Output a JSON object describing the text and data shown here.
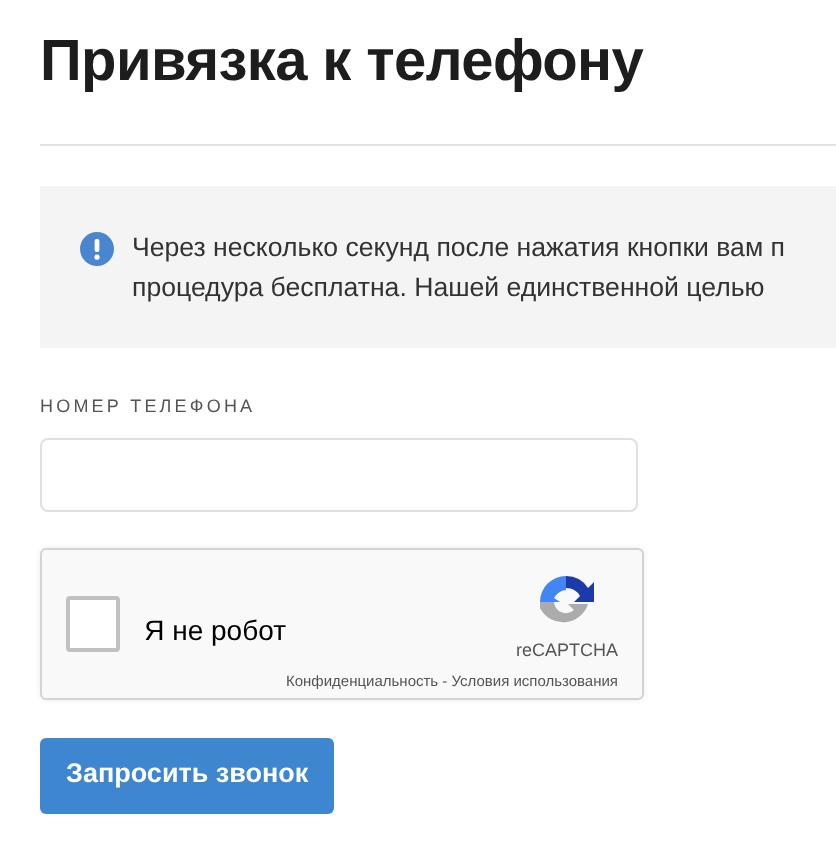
{
  "title": "Привязка к телефону",
  "notice": {
    "lines": [
      "Через несколько секунд после нажатия кнопки вам п",
      "процедура бесплатна. Нашей единственной целью"
    ]
  },
  "phone_field": {
    "label": "НОМЕР ТЕЛЕФОНА"
  },
  "captcha": {
    "label": "Я не робот",
    "checked": false,
    "brand": "reCAPTCHA",
    "links": [
      "Конфиденциальность",
      "Условия использования"
    ],
    "separator": "-"
  },
  "submit_button": "Запросить звонок"
}
